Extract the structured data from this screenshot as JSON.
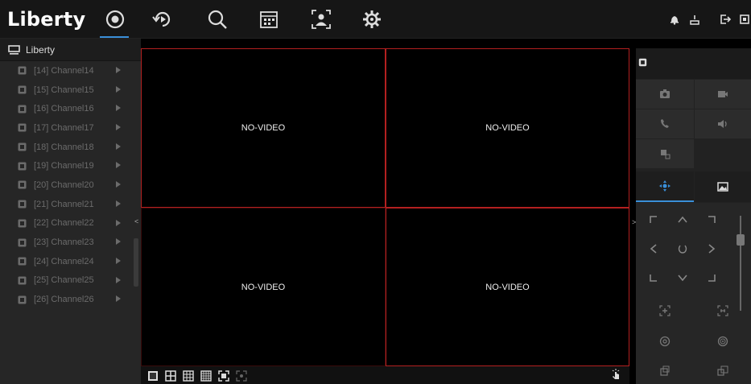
{
  "app": {
    "logo_text": "Liberty",
    "accent_color": "#3a8fd8",
    "selected_border_color": "#b32020"
  },
  "top_nav": {
    "items": [
      {
        "name": "live-view-icon",
        "active": true
      },
      {
        "name": "playback-icon",
        "active": false
      },
      {
        "name": "search-icon",
        "active": false
      },
      {
        "name": "calendar-icon",
        "active": false
      },
      {
        "name": "face-recognition-icon",
        "active": false
      },
      {
        "name": "settings-gear-icon",
        "active": false
      }
    ],
    "right_icons": [
      "alarm-bell-icon",
      "user-icon",
      "logout-icon",
      "fullscreen-icon"
    ]
  },
  "sidebar": {
    "root_label": "Liberty",
    "channels": [
      {
        "label": "[14] Channel14"
      },
      {
        "label": "[15] Channel15"
      },
      {
        "label": "[16] Channel16"
      },
      {
        "label": "[17] Channel17"
      },
      {
        "label": "[18] Channel18"
      },
      {
        "label": "[19] Channel19"
      },
      {
        "label": "[20] Channel20"
      },
      {
        "label": "[21] Channel21"
      },
      {
        "label": "[22] Channel22"
      },
      {
        "label": "[23] Channel23"
      },
      {
        "label": "[24] Channel24"
      },
      {
        "label": "[25] Channel25"
      },
      {
        "label": "[26] Channel26"
      }
    ],
    "collapse_glyph": "<"
  },
  "video": {
    "tiles": [
      {
        "text": "NO-VIDEO",
        "selected": true
      },
      {
        "text": "NO-VIDEO",
        "selected": true
      },
      {
        "text": "NO-VIDEO",
        "selected": false
      },
      {
        "text": "NO-VIDEO",
        "selected": true
      }
    ],
    "layout_buttons": [
      "1x1-layout-icon",
      "2x2-layout-icon",
      "3x3-layout-icon",
      "4x4-layout-icon",
      "fullscreen-layout-icon",
      "fit-layout-icon"
    ],
    "expand_glyph": ">"
  },
  "right_panel": {
    "top_buttons": [
      "snapshot-icon",
      "record-icon",
      "talk-icon",
      "audio-icon",
      "zoom-icon"
    ],
    "tabs": [
      "ptz-tab-icon",
      "image-tab-icon"
    ],
    "ptz_directions": [
      "up-left",
      "up",
      "up-right",
      "left",
      "auto-scan",
      "right",
      "down-left",
      "down",
      "down-right"
    ],
    "ptz_extra": [
      "zoom-in-icon",
      "zoom-out-icon",
      "focus-near-icon",
      "focus-far-icon",
      "iris-open-icon",
      "iris-close-icon"
    ]
  }
}
